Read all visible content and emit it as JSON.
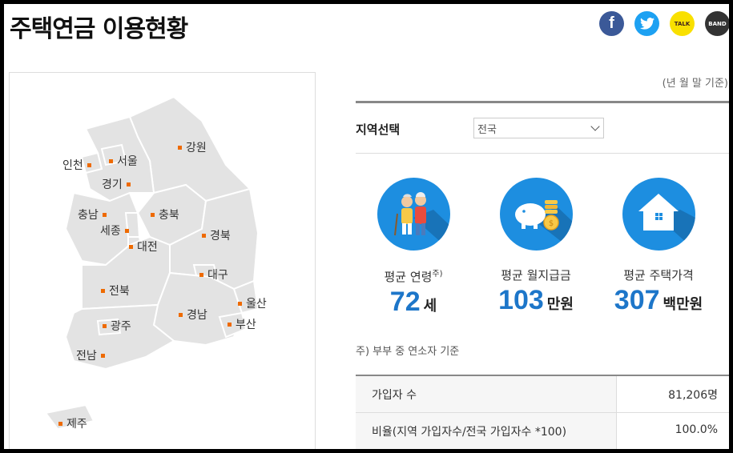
{
  "title": "주택연금 이용현황",
  "share": {
    "facebook": "f",
    "twitter": "twitter-bird",
    "kakao": "TALK",
    "band": "BAND"
  },
  "map": {
    "regions": [
      {
        "name": "인천"
      },
      {
        "name": "서울"
      },
      {
        "name": "강원"
      },
      {
        "name": "경기"
      },
      {
        "name": "충남"
      },
      {
        "name": "충북"
      },
      {
        "name": "세종"
      },
      {
        "name": "대전"
      },
      {
        "name": "경북"
      },
      {
        "name": "대구"
      },
      {
        "name": "전북"
      },
      {
        "name": "울산"
      },
      {
        "name": "경남"
      },
      {
        "name": "광주"
      },
      {
        "name": "부산"
      },
      {
        "name": "전남"
      },
      {
        "name": "제주"
      }
    ]
  },
  "basis_note": "(년 월 말 기준)",
  "region_select": {
    "label": "지역선택",
    "value": "전국"
  },
  "stats": {
    "age": {
      "label": "평균 연령",
      "sup": "주)",
      "value": "72",
      "unit": "세"
    },
    "payment": {
      "label": "평균 월지급금",
      "value": "103",
      "unit": "만원"
    },
    "house": {
      "label": "평균 주택가격",
      "value": "307",
      "unit": "백만원"
    }
  },
  "footnote": "주) 부부 중 연소자 기준",
  "table": {
    "rows": [
      {
        "key": "가입자 수",
        "value": "81,206명"
      },
      {
        "key": "비율(지역 가입자수/전국 가입자수 *100)",
        "value": "100.0%"
      }
    ]
  },
  "colors": {
    "accent": "#1d8ee0",
    "number": "#1d76c9",
    "marker": "#ee6a00",
    "map_fill": "#e3e3e3"
  }
}
